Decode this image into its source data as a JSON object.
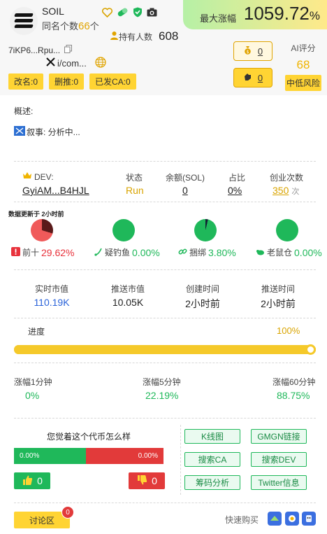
{
  "header": {
    "token_name": "SOIL",
    "same_name_label": "同名个数",
    "same_name_count": "66",
    "same_name_unit": "个",
    "holders_label": "持有人数",
    "holders_count": "608",
    "max_rise_label": "最大涨幅",
    "max_rise_value": "1059.72",
    "max_rise_unit": "%",
    "ca_short": "7iKP6...Rpu...",
    "twitter_short": "i/com...",
    "tags": [
      "改名:0",
      "删推:0",
      "已发CA:0"
    ],
    "bag_count": "0",
    "hand_count": "0",
    "ai_label": "AI评分",
    "ai_score": "68",
    "ai_risk": "中低风险",
    "icons": [
      "heart-icon",
      "pill-icon",
      "shield-icon",
      "camera-icon",
      "copy-icon",
      "x-logo-icon",
      "globe-icon"
    ]
  },
  "overview": {
    "label": "概述:",
    "narrative": "叙事: 分析中..."
  },
  "dev": {
    "headers": [
      "DEV:",
      "状态",
      "余额(SOL)",
      "占比",
      "创业次数"
    ],
    "address": "GyiAM...B4HJL",
    "status": "Run",
    "balance": "0",
    "share": "0%",
    "ventures": "350",
    "ventures_unit": "次"
  },
  "holders_stats": {
    "update_note": "数据更新于 2小时前",
    "items": [
      {
        "label": "前十",
        "value": "29.62%"
      },
      {
        "label": "疑钓鱼",
        "value": "0.00%"
      },
      {
        "label": "捆绑",
        "value": "3.80%"
      },
      {
        "label": "老鼠仓",
        "value": "0.00%"
      }
    ]
  },
  "market": {
    "headers": [
      "实时市值",
      "推送市值",
      "创建时间",
      "推送时间"
    ],
    "values": [
      "110.19K",
      "10.05K",
      "2小时前",
      "2小时前"
    ]
  },
  "progress": {
    "label": "进度",
    "value": "100%",
    "fraction": 1.0
  },
  "rise": {
    "headers": [
      "涨幅1分钟",
      "涨幅5分钟",
      "涨幅60分钟"
    ],
    "values": [
      "0%",
      "22.19%",
      "88.75%"
    ]
  },
  "vote": {
    "title": "您觉着这个代币怎么样",
    "up_pct": "0.00%",
    "down_pct": "0.00%",
    "up_count": "0",
    "down_count": "0"
  },
  "links": [
    "K线图",
    "GMGN链接",
    "搜索CA",
    "搜索DEV",
    "筹码分析",
    "Twitter信息"
  ],
  "footer": {
    "discuss": "讨论区",
    "discuss_badge": "0",
    "quick_buy": "快速购买"
  },
  "colors": {
    "accent_yellow": "#ffd433",
    "green": "#1fb85a",
    "red": "#e23a3a",
    "blue": "#2962d9"
  }
}
